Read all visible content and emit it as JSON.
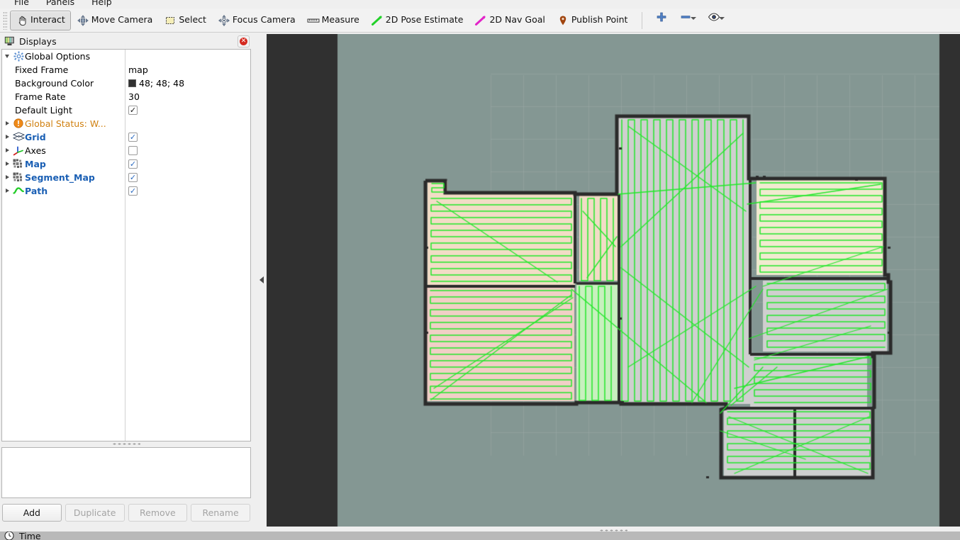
{
  "menubar": {
    "items": [
      {
        "label": "File"
      },
      {
        "label": "Panels"
      },
      {
        "label": "Help"
      }
    ]
  },
  "toolbar": {
    "tools": [
      {
        "label": "Interact",
        "icon": "hand-cursor-icon",
        "active": true
      },
      {
        "label": "Move Camera",
        "icon": "move-camera-icon",
        "active": false
      },
      {
        "label": "Select",
        "icon": "select-box-icon",
        "active": false
      },
      {
        "label": "Focus Camera",
        "icon": "focus-camera-icon",
        "active": false
      },
      {
        "label": "Measure",
        "icon": "ruler-icon",
        "active": false
      },
      {
        "label": "2D Pose Estimate",
        "icon": "green-arrow-icon",
        "active": false
      },
      {
        "label": "2D Nav Goal",
        "icon": "magenta-arrow-icon",
        "active": false
      },
      {
        "label": "Publish Point",
        "icon": "map-pin-icon",
        "active": false
      }
    ],
    "zoom_controls": [
      {
        "name": "plus-icon",
        "glyph": "+",
        "has_menu": false
      },
      {
        "name": "minus-icon",
        "glyph": "-",
        "has_menu": true
      },
      {
        "name": "eye-icon",
        "glyph": "eye",
        "has_menu": true
      }
    ]
  },
  "displays_panel": {
    "title": "Displays",
    "title_icon": "displays-panel-icon",
    "close_icon": "close-icon",
    "tree": [
      {
        "label": "Global Options",
        "kind": "group",
        "expanded": true,
        "icon": "gear-icon",
        "style": "plain",
        "value_type": "none"
      },
      {
        "label": "Fixed Frame",
        "kind": "property",
        "icon": "none",
        "style": "prop",
        "value_type": "text",
        "value": "map"
      },
      {
        "label": "Background Color",
        "kind": "property",
        "icon": "none",
        "style": "prop",
        "value_type": "color",
        "value": "48; 48; 48",
        "color_hex": "#303030"
      },
      {
        "label": "Frame Rate",
        "kind": "property",
        "icon": "none",
        "style": "prop",
        "value_type": "text",
        "value": "30"
      },
      {
        "label": "Default Light",
        "kind": "property",
        "icon": "none",
        "style": "prop",
        "value_type": "check-black",
        "value": "checked"
      },
      {
        "label": "Global Status: W...",
        "kind": "status",
        "expanded": false,
        "icon": "warning-icon",
        "style": "warn",
        "value_type": "none"
      },
      {
        "label": "Grid",
        "kind": "display",
        "expanded": false,
        "icon": "grid-icon",
        "style": "enabled",
        "value_type": "check-blue",
        "value": "checked"
      },
      {
        "label": "Axes",
        "kind": "display",
        "expanded": false,
        "icon": "axes-icon",
        "style": "plain",
        "value_type": "check-blue",
        "value": "unchecked"
      },
      {
        "label": "Map",
        "kind": "display",
        "expanded": false,
        "icon": "map-icon",
        "style": "enabled",
        "value_type": "check-blue",
        "value": "checked"
      },
      {
        "label": "Segment_Map",
        "kind": "display",
        "expanded": false,
        "icon": "map-icon",
        "style": "enabled",
        "value_type": "check-blue",
        "value": "checked"
      },
      {
        "label": "Path",
        "kind": "display",
        "expanded": false,
        "icon": "path-icon",
        "style": "enabled",
        "value_type": "check-blue",
        "value": "checked"
      }
    ],
    "buttons": [
      {
        "label": "Add",
        "enabled": true
      },
      {
        "label": "Duplicate",
        "enabled": false
      },
      {
        "label": "Remove",
        "enabled": false
      },
      {
        "label": "Rename",
        "enabled": false
      }
    ]
  },
  "time_panel": {
    "title": "Time",
    "icon": "clock-icon"
  },
  "view": {
    "background_color": "#303030",
    "ground_color": "#849793",
    "grid_line_color": "#9aa9a6",
    "grid_spacing_px": 46,
    "path_color": "#22e82a",
    "wall_color": "#2b2b2b",
    "segment_colors": {
      "peach": "#f2dcc6",
      "pink": "#f1cfc6",
      "green": "#c8f0bf",
      "gray": "#cfcfcf",
      "cream": "#f1ead0"
    }
  }
}
